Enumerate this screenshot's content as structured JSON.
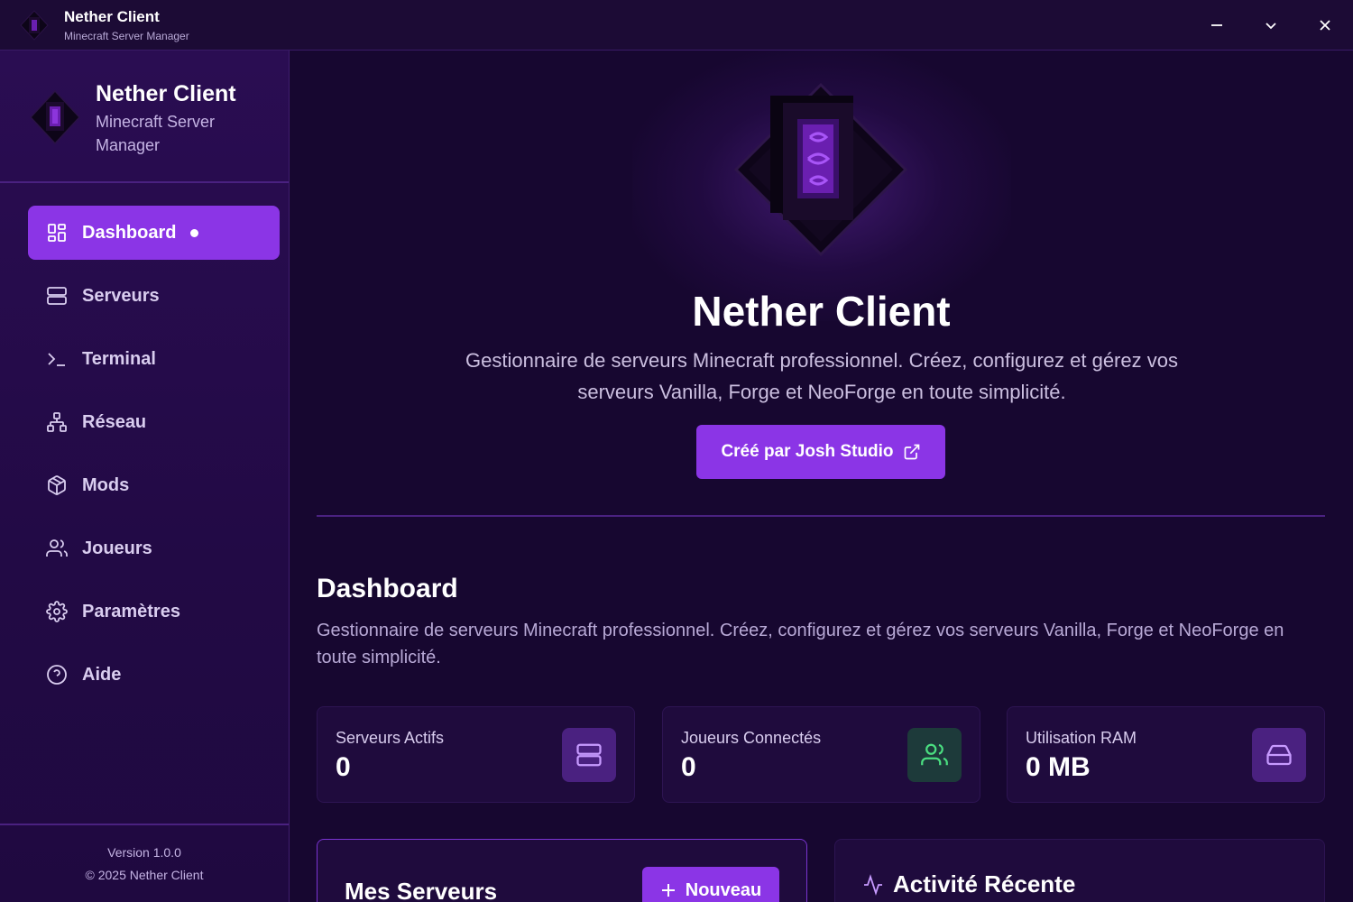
{
  "titlebar": {
    "title": "Nether Client",
    "subtitle": "Minecraft Server Manager"
  },
  "sidebar": {
    "brand_title": "Nether Client",
    "brand_subtitle": "Minecraft Server Manager",
    "items": [
      {
        "label": "Dashboard",
        "icon": "dashboard-grid-icon",
        "active": true
      },
      {
        "label": "Serveurs",
        "icon": "server-icon",
        "active": false
      },
      {
        "label": "Terminal",
        "icon": "terminal-icon",
        "active": false
      },
      {
        "label": "Réseau",
        "icon": "network-icon",
        "active": false
      },
      {
        "label": "Mods",
        "icon": "package-icon",
        "active": false
      },
      {
        "label": "Joueurs",
        "icon": "users-icon",
        "active": false
      },
      {
        "label": "Paramètres",
        "icon": "gear-icon",
        "active": false
      },
      {
        "label": "Aide",
        "icon": "help-circle-icon",
        "active": false
      }
    ],
    "version": "Version 1.0.0",
    "copyright": "© 2025 Nether Client"
  },
  "hero": {
    "title": "Nether Client",
    "description": "Gestionnaire de serveurs Minecraft professionnel. Créez, configurez et gérez vos serveurs Vanilla, Forge et NeoForge en toute simplicité.",
    "button_label": "Créé par Josh Studio"
  },
  "dashboard": {
    "title": "Dashboard",
    "description": "Gestionnaire de serveurs Minecraft professionnel. Créez, configurez et gérez vos serveurs Vanilla, Forge et NeoForge en toute simplicité.",
    "stats": [
      {
        "label": "Serveurs Actifs",
        "value": "0",
        "icon": "server-icon",
        "icon_color": "#c79bff",
        "icon_bg": "#4a2180"
      },
      {
        "label": "Joueurs Connectés",
        "value": "0",
        "icon": "users-icon",
        "icon_color": "#4ade80",
        "icon_bg": "#1d3a3a"
      },
      {
        "label": "Utilisation RAM",
        "value": "0 MB",
        "icon": "hard-drive-icon",
        "icon_color": "#c79bff",
        "icon_bg": "#4a2180"
      }
    ]
  },
  "servers_panel": {
    "title": "Mes Serveurs",
    "new_button": "Nouveau"
  },
  "activity_panel": {
    "title": "Activité Récente"
  },
  "colors": {
    "accent": "#8b35e6",
    "background": "#170730",
    "sidebar": "#2a0d52"
  }
}
